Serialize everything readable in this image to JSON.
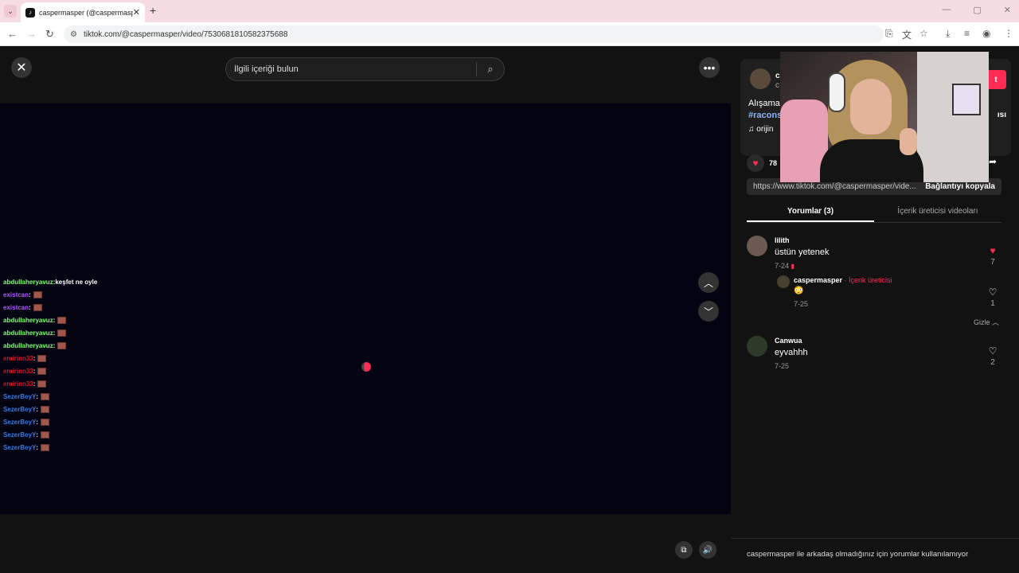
{
  "browser": {
    "tab_title": "caspermasper (@caspermasper",
    "url": "tiktok.com/@caspermasper/video/7530681810582375688"
  },
  "search": {
    "placeholder": "İlgili içeriği bulun"
  },
  "chat": [
    {
      "user": "abdullaheryavuz",
      "sep": " : ",
      "text": "keşfet ne oyle",
      "color": "#7dff6b"
    },
    {
      "user": "existcan",
      "sep": " : ",
      "text": "",
      "color": "#b455ff"
    },
    {
      "user": "existcan",
      "sep": " : ",
      "text": "",
      "color": "#b455ff"
    },
    {
      "user": "abdullaheryavuz",
      "sep": " : ",
      "text": "",
      "color": "#7dff6b"
    },
    {
      "user": "abdullaheryavuz",
      "sep": " : ",
      "text": "",
      "color": "#7dff6b"
    },
    {
      "user": "abdullaheryavuz",
      "sep": " : ",
      "text": "",
      "color": "#7dff6b"
    },
    {
      "user": "emirinn33",
      "sep": " : ",
      "text": "",
      "color": "#e0102e"
    },
    {
      "user": "emirinn33",
      "sep": " : ",
      "text": "",
      "color": "#e0102e"
    },
    {
      "user": "emirinn33",
      "sep": " : ",
      "text": "",
      "color": "#e0102e"
    },
    {
      "user": "SezerBeyY",
      "sep": " : ",
      "text": "",
      "color": "#3c7be0"
    },
    {
      "user": "SezerBeyY",
      "sep": " : ",
      "text": "",
      "color": "#3c7be0"
    },
    {
      "user": "SezerBeyY",
      "sep": " : ",
      "text": "",
      "color": "#3c7be0"
    },
    {
      "user": "SezerBeyY",
      "sep": " : ",
      "text": "",
      "color": "#3c7be0"
    },
    {
      "user": "SezerBeyY",
      "sep": " : ",
      "text": "",
      "color": "#3c7be0"
    }
  ],
  "info": {
    "name_fragment": "c",
    "name_fragment2": "c",
    "follow_fragment": "t",
    "desc_fragment": "Alışama",
    "hashtag_fragment": "#racons",
    "tail_fragment": "ısı",
    "music_fragment": "orijin"
  },
  "actions": {
    "likes": "78"
  },
  "link": {
    "url": "https://www.tiktok.com/@caspermasper/vide...",
    "copy": "Bağlantıyı kopyala"
  },
  "tabs": {
    "comments": "Yorumlar (3)",
    "creator_videos": "İçerik üreticisi videoları"
  },
  "comments": [
    {
      "name": "lilith",
      "text": "üstün yetenek",
      "date": "7-24",
      "likes": "7",
      "liked": true
    },
    {
      "name": "Canwua",
      "text": "eyvahhh",
      "date": "7-25",
      "likes": "2",
      "liked": false
    }
  ],
  "reply": {
    "name": "caspermasper",
    "sep": " · ",
    "badge": "İçerik üreticisi",
    "emoji": "😳",
    "date": "7-25",
    "likes": "1"
  },
  "hide_label": "Gizle",
  "notice": "caspermasper ile arkadaş olmadığınız için yorumlar kullanılamıyor",
  "colors": {
    "accent": "#fe2c55"
  }
}
